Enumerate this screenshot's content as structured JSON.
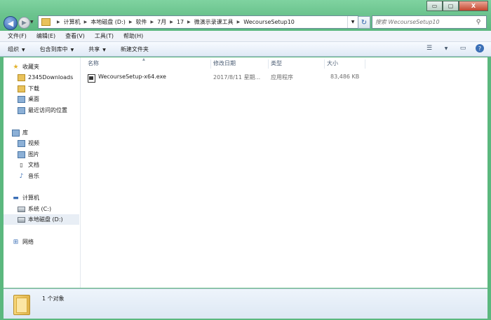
{
  "window": {
    "controls": {
      "minimize": "▭",
      "maximize": "▢",
      "close": "X"
    }
  },
  "nav": {
    "back_glyph": "◀",
    "forward_glyph": "▶",
    "breadcrumb": [
      "计算机",
      "本地磁盘 (D:)",
      "软件",
      "7月",
      "17",
      "微演示录课工具",
      "WecourseSetup10"
    ],
    "refresh_glyph": "↻",
    "search_placeholder": "搜索 WecourseSetup10"
  },
  "menubar": [
    "文件(F)",
    "编辑(E)",
    "查看(V)",
    "工具(T)",
    "帮助(H)"
  ],
  "toolbar": {
    "organize": "组织",
    "include_in_library": "包含到库中",
    "share": "共享",
    "new_folder": "新建文件夹"
  },
  "sidebar": {
    "favorites": {
      "label": "收藏夹",
      "items": [
        "2345Downloads",
        "下载",
        "桌面",
        "最近访问的位置"
      ]
    },
    "libraries": {
      "label": "库",
      "items": [
        "视频",
        "图片",
        "文档",
        "音乐"
      ]
    },
    "computer": {
      "label": "计算机",
      "items": [
        "系统 (C:)",
        "本地磁盘 (D:)"
      ]
    },
    "network": {
      "label": "网络"
    }
  },
  "columns": {
    "name": "名称",
    "date": "修改日期",
    "type": "类型",
    "size": "大小"
  },
  "files": [
    {
      "name": "WecourseSetup-x64.exe",
      "date": "2017/8/11 星期...",
      "type": "应用程序",
      "size": "83,486 KB"
    }
  ],
  "status": {
    "count": "1 个对象"
  },
  "colors": {
    "frame": "#6cc48f",
    "toolbar": "#dfe9f5",
    "selection": "#e8eef5"
  }
}
